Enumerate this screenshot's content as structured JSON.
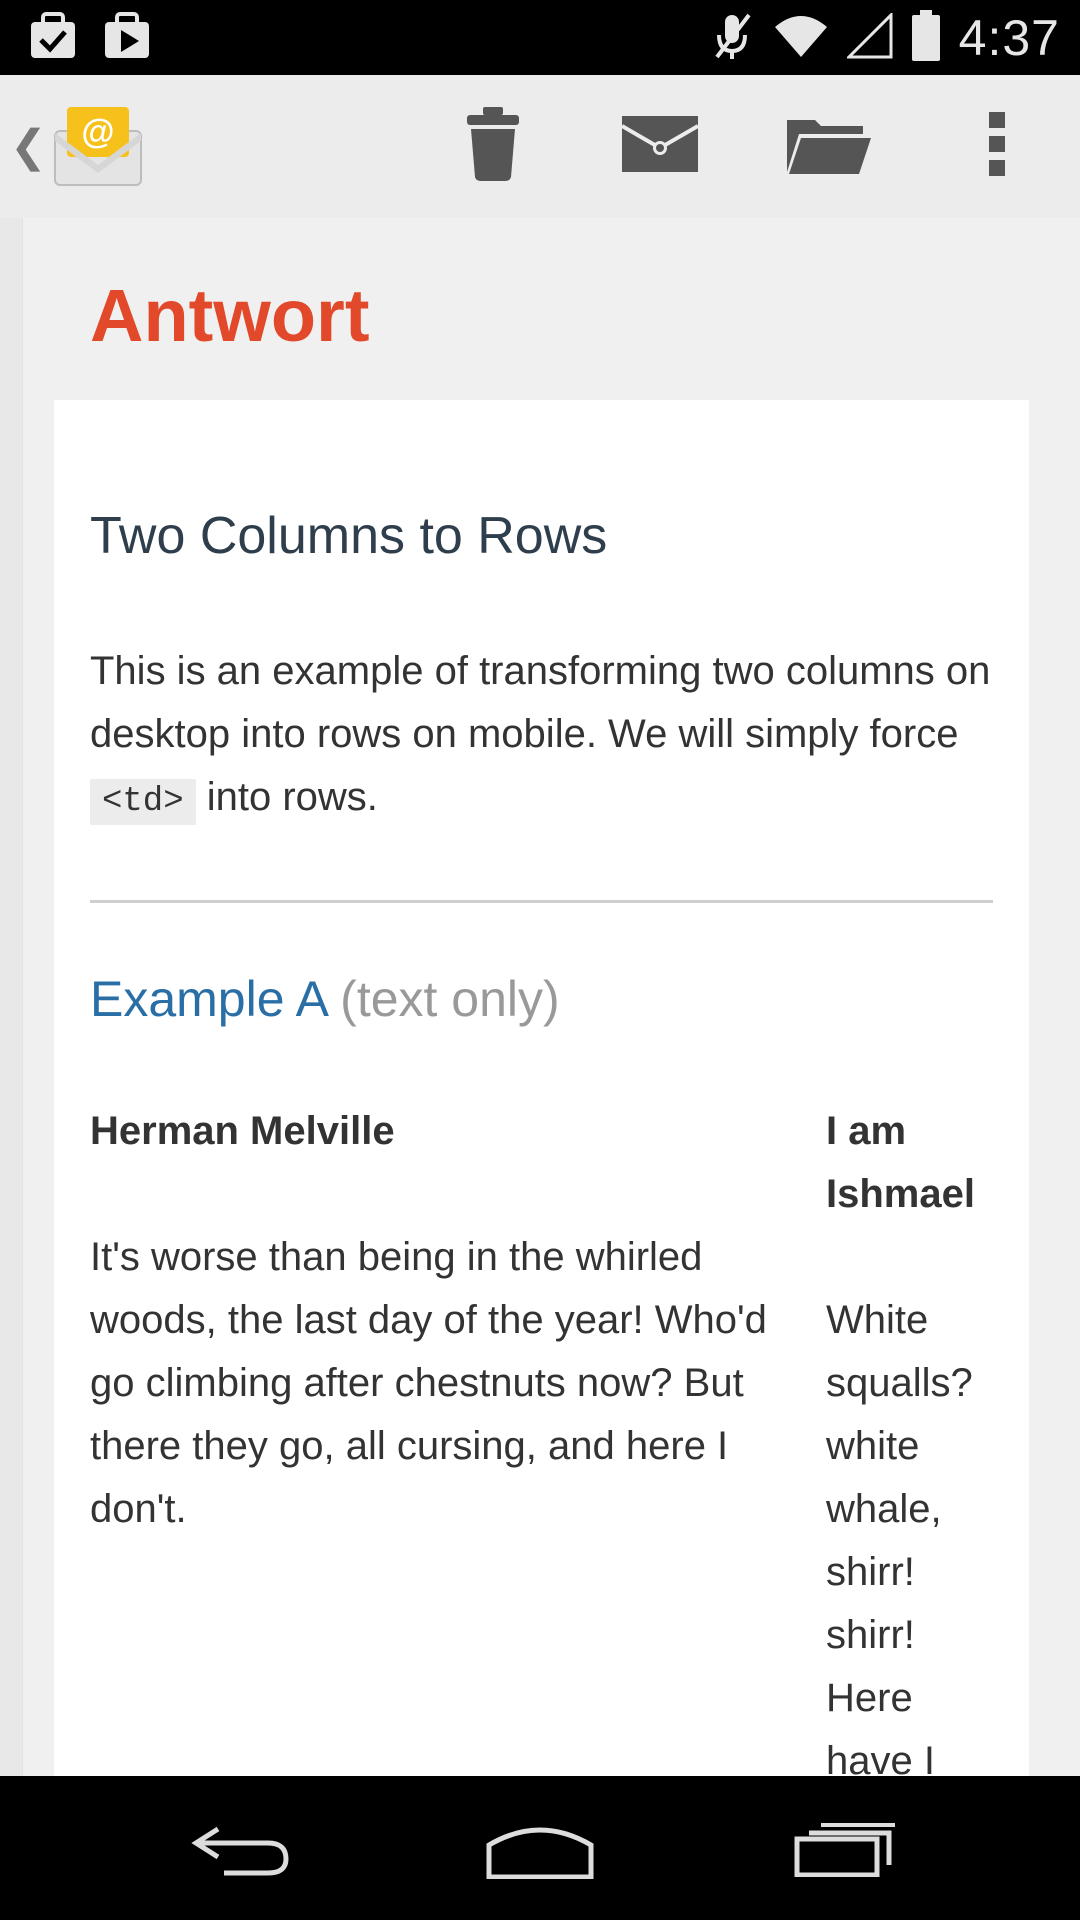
{
  "status_bar": {
    "time": "4:37",
    "icons": [
      "task-check-icon",
      "play-store-icon",
      "mute-icon",
      "wifi-icon",
      "signal-icon",
      "battery-icon"
    ]
  },
  "action_bar": {
    "app_icon": "email-app-icon",
    "actions": [
      "delete-icon",
      "mark-unread-icon",
      "move-to-folder-icon",
      "overflow-menu-icon"
    ]
  },
  "message": {
    "subject": "Antwort",
    "title": "Two Columns to Rows",
    "intro_before": "This is an example of transforming two columns on desktop into rows on mobile. We will simply force ",
    "intro_code": "<td>",
    "intro_after": " into rows.",
    "example_label": "Example A",
    "example_note": "(text only)",
    "left_column": {
      "heading": "Herman Melville",
      "text": "It's worse than being in the whirled woods, the last day of the year! Who'd go climbing after chestnuts now? But there they go, all cursing, and here I don't."
    },
    "right_column": {
      "heading": "I am Ishmael",
      "text": "White squalls? white whale, shirr! shirr! Here have I"
    }
  },
  "nav_bar": {
    "buttons": [
      "back-icon",
      "home-icon",
      "recent-apps-icon"
    ]
  },
  "colors": {
    "subject": "#e2492a",
    "title": "#2f3e4c",
    "link": "#2a6ea6",
    "muted": "#999999"
  }
}
